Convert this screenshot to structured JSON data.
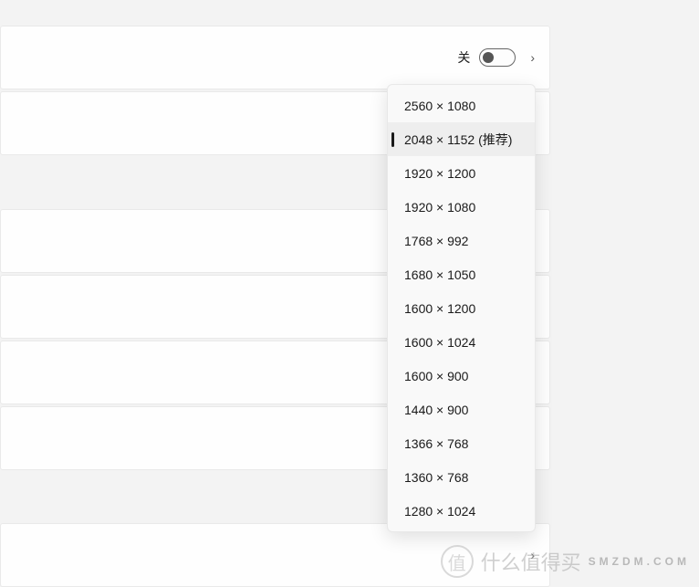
{
  "toggle": {
    "label": "关",
    "state": "off"
  },
  "resolution_dropdown": {
    "selected_index": 1,
    "options": [
      "2560 × 1080",
      "2048 × 1152 (推荐)",
      "1920 × 1200",
      "1920 × 1080",
      "1768 × 992",
      "1680 × 1050",
      "1600 × 1200",
      "1600 × 1024",
      "1600 × 900",
      "1440 × 900",
      "1366 × 768",
      "1360 × 768",
      "1280 × 1024"
    ]
  },
  "watermark": {
    "icon": "值",
    "text": "什么值得买",
    "sub": "SMZDM.COM"
  }
}
